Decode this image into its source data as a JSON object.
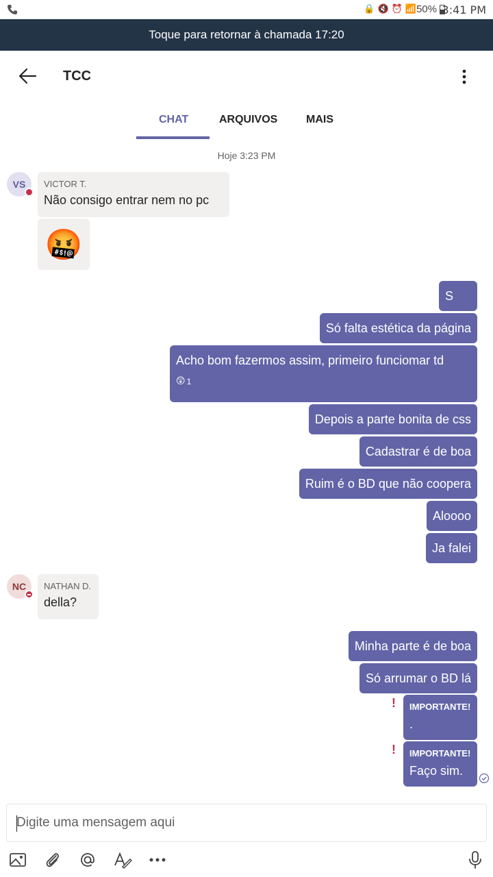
{
  "status_bar": {
    "battery": "50%",
    "time": "3:41 PM"
  },
  "call_banner": {
    "text": "Toque para retornar à chamada 17:20"
  },
  "header": {
    "title": "TCC"
  },
  "tabs": [
    {
      "label": "CHAT",
      "active": true
    },
    {
      "label": "ARQUIVOS",
      "active": false
    },
    {
      "label": "MAIS",
      "active": false
    }
  ],
  "date_separator": "Hoje 3:23 PM",
  "messages": {
    "victor": {
      "initials": "VS",
      "sender": "VICTOR T.",
      "text": "Não consigo entrar nem no pc",
      "emoji": "🤬"
    },
    "outgoing_1": [
      {
        "text": "S"
      },
      {
        "text": "Só falta estética da página"
      },
      {
        "text": "Acho bom fazermos assim, primeiro funciomar td",
        "reaction_emoji": "😲",
        "reaction_count": "1"
      },
      {
        "text": "Depois a parte bonita de css"
      },
      {
        "text": "Cadastrar é de boa"
      },
      {
        "text": "Ruim é o BD que não coopera"
      },
      {
        "text": "Aloooo"
      },
      {
        "text": "Ja falei"
      }
    ],
    "nathan": {
      "initials": "NC",
      "sender": "NATHAN D.",
      "text": "della?"
    },
    "outgoing_2": [
      {
        "text": "Minha parte é de boa"
      },
      {
        "text": "Só arrumar o BD lá"
      },
      {
        "label": "IMPORTANTE!",
        "text": "."
      },
      {
        "label": "IMPORTANTE!",
        "text": "Faço sim."
      }
    ]
  },
  "compose": {
    "placeholder": "Digite uma mensagem aqui"
  },
  "colors": {
    "accent": "#6264a7",
    "banner": "#243447",
    "incoming_bubble": "#f1f0ef",
    "important": "#c4314b"
  }
}
